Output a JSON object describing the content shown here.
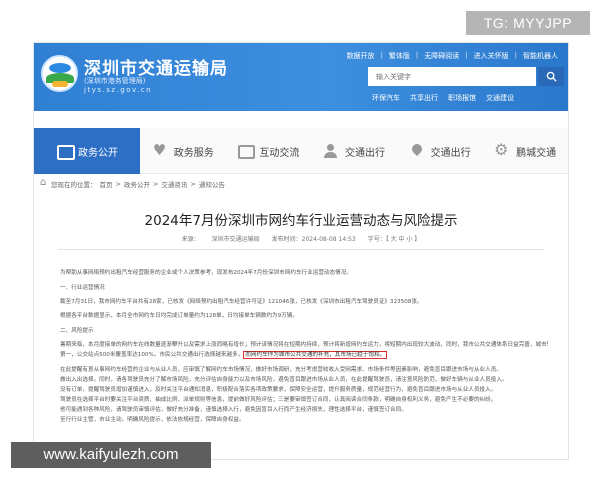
{
  "watermark_top": "TG: MYYJPP",
  "watermark_bottom": "www.kaifyulezh.com",
  "header": {
    "title": "深圳市交通运输局",
    "subtitle": "(深圳市港务管理局)",
    "url": "jtys.sz.gov.cn",
    "toplinks": [
      "数据开放",
      "繁体版",
      "无障碍阅读",
      "进入关怀版",
      "智能机器人"
    ],
    "search_placeholder": "输入关键字",
    "quicklinks": [
      "环保汽车",
      "共享出行",
      "职场报馆",
      "交通建设"
    ]
  },
  "nav": {
    "items": [
      {
        "label": "政务公开",
        "icon": "book-icon"
      },
      {
        "label": "政务服务",
        "icon": "heart-icon"
      },
      {
        "label": "互动交流",
        "icon": "chat-icon"
      },
      {
        "label": "交通出行",
        "icon": "user-icon"
      },
      {
        "label": "交通出行",
        "icon": "pin-icon"
      },
      {
        "label": "鹏城交通",
        "icon": "gear-icon"
      }
    ]
  },
  "breadcrumb": {
    "prefix": "您现在的位置：",
    "items": [
      "首页",
      "政务公开",
      "交通资讯",
      "通知公告"
    ],
    "separator": ">"
  },
  "article": {
    "title": "2024年7月份深圳市网约车行业运营动态与风险提示",
    "meta": [
      "来源：",
      "深圳市交通运输局",
      "发布时间：2024-08-08 14:53",
      "字号：【 大 中 小 】"
    ],
    "intro": "为帮助从事网络预约出租汽车经营服务的企业或个人决策参考，现发布2024年7月份深圳市网约车行业运营动态情况。",
    "heading1": "一、行业运营情况",
    "para1": "截至7月31日，我市网约车平台共有28家，已核发《网络预约出租汽车经营许可证》121046张，已核发《深圳市出租汽车驾驶员证》323508张。",
    "para2": "根据各平台数据显示，本月全市网约车日均完成订单量约为128单，日均接单车辆数约为9万辆。",
    "heading2": "二、风险提示",
    "risk_line1": "暑期来临，本月度接单的网约车在线数量逐渐攀升以及需求上涨而略有增长；预计该情况将在短期内持续，预计将新增网约车运力，将短期内出现较大波动。同时，我市公共交通体系日益完善，城市轨道交通线网现实已经达到国内",
    "risk_line2": "第一，公交站点500米覆盖率达100%，市民公共交通出行选择越来越多，",
    "risk_highlight": "而网约车作为城市公共交通的补充，其市场已趋于饱和。",
    "risk_line3": "在此提醒有意从事网约车经营的企业与从业人员，应审慎了解网约车市场情况，做好市场调研，充分考虑营收收入受网需求、市场条件等因素影响，避免盲目跟进市场与从业人员。",
    "risk_line4": "做出入出选择。同时，请各驾驶员充分了解市场风险，充分评估自身能力以及市场风险，避免盲目跟进市场从业人员，在此提醒驾驶员，请注意风险防范，做好车辆与从业人员投入。",
    "risk_line5": "没有订单，提醒驾驶员增加谨慎进入，及时关注平台通知消息，积极配合落实各项政策要求，保障安全运营，提升服务质量，规范经营行为，避免盲目跟进市场与从业人员投入。",
    "risk_line6": "驾驶员在选择平台时要关注平台资质、抽成比例、派单规则等信息，提前做好风险评估；三是要审慎签订合同，认真阅读合同条款，明确自身权利义务，避免产生不必要的纠纷。",
    "risk_line7": "他可能遇到各种风险，请驾驶员审慎评估，做好充分准备，谨慎选择入行，避免因盲目入行而产生经济损失，理性选择平台，谨慎签订合同。",
    "risk_line8": "至行行业主管，市业主动，明确风险提示，依法依规经营，保障自身权益。"
  }
}
